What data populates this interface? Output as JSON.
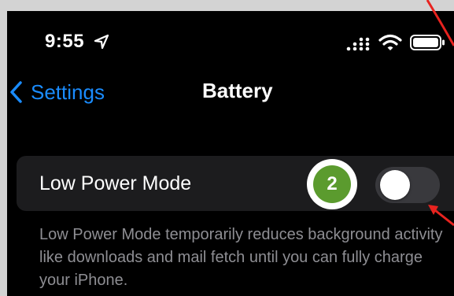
{
  "status_bar": {
    "time": "9:55",
    "icons": [
      "location-arrow-icon",
      "signal-bars-icon",
      "wifi-icon",
      "battery-icon"
    ]
  },
  "nav": {
    "back_label": "Settings",
    "title": "Battery"
  },
  "low_power": {
    "label": "Low Power Mode",
    "badge_number": "2",
    "toggle_on": false,
    "description": "Low Power Mode temporarily reduces background activity like downloads and mail fetch until you can fully charge your iPhone."
  },
  "colors": {
    "accent_blue": "#1a8cff",
    "badge_green": "#5b9b2e",
    "annotation_red": "#e8231f"
  }
}
